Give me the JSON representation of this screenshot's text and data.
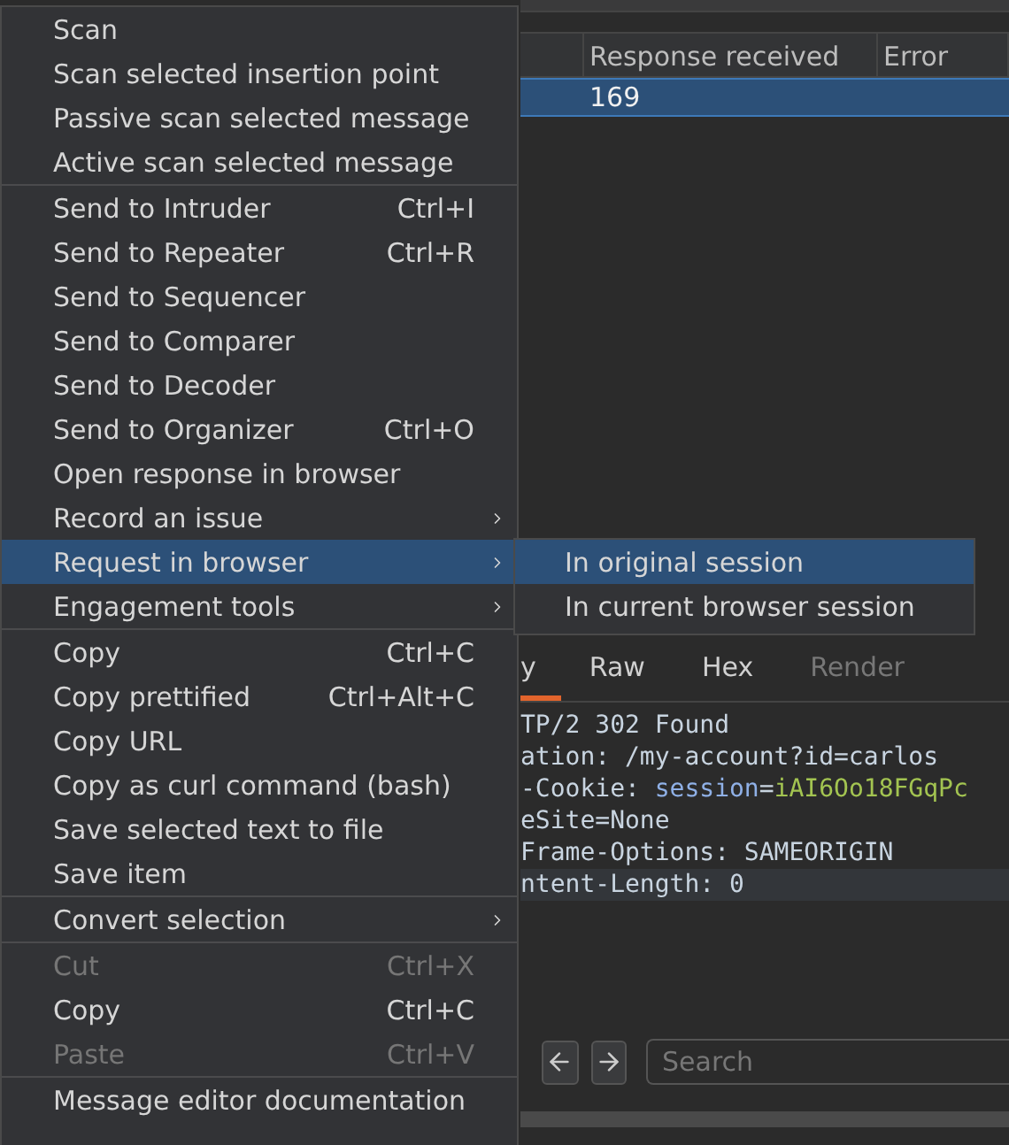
{
  "table": {
    "columns": [
      {
        "label": "Response received"
      },
      {
        "label": "Error"
      }
    ],
    "rows": [
      {
        "cells": [
          "169",
          ""
        ],
        "selected": true
      }
    ]
  },
  "editor": {
    "tabs": [
      {
        "label": "y",
        "selected": true,
        "disabled": false
      },
      {
        "label": "Raw",
        "selected": false,
        "disabled": false
      },
      {
        "label": "Hex",
        "selected": false,
        "disabled": false
      },
      {
        "label": "Render",
        "selected": false,
        "disabled": true
      }
    ],
    "lines": [
      {
        "highlighted": false,
        "segments": [
          {
            "kind": "plain",
            "text": "TP/2 302 Found"
          }
        ]
      },
      {
        "highlighted": false,
        "segments": [
          {
            "kind": "plain",
            "text": "ation: /my-account?id=carlos"
          }
        ]
      },
      {
        "highlighted": false,
        "segments": [
          {
            "kind": "plain",
            "text": "-Cookie: "
          },
          {
            "kind": "name",
            "text": "session"
          },
          {
            "kind": "plain",
            "text": "="
          },
          {
            "kind": "value",
            "text": "iAI6Oo18FGqPc"
          }
        ]
      },
      {
        "highlighted": false,
        "segments": [
          {
            "kind": "plain",
            "text": "eSite=None"
          }
        ]
      },
      {
        "highlighted": false,
        "segments": [
          {
            "kind": "plain",
            "text": "Frame-Options: SAMEORIGIN"
          }
        ]
      },
      {
        "highlighted": true,
        "segments": [
          {
            "kind": "plain",
            "text": "ntent-Length: 0"
          }
        ]
      }
    ],
    "search": {
      "placeholder": "Search"
    }
  },
  "context_menu": {
    "sections": [
      {
        "items": [
          {
            "label": "Scan"
          },
          {
            "label": "Scan selected insertion point"
          },
          {
            "label": "Passive scan selected message"
          },
          {
            "label": "Active scan selected message"
          }
        ]
      },
      {
        "items": [
          {
            "label": "Send to Intruder",
            "shortcut": "Ctrl+I"
          },
          {
            "label": "Send to Repeater",
            "shortcut": "Ctrl+R"
          },
          {
            "label": "Send to Sequencer"
          },
          {
            "label": "Send to Comparer"
          },
          {
            "label": "Send to Decoder"
          },
          {
            "label": "Send to Organizer",
            "shortcut": "Ctrl+O"
          },
          {
            "label": "Open response in browser"
          },
          {
            "label": "Record an issue",
            "submenu": true
          },
          {
            "label": "Request in browser",
            "submenu": true,
            "selected": true
          },
          {
            "label": "Engagement tools",
            "submenu": true
          }
        ]
      },
      {
        "items": [
          {
            "label": "Copy",
            "shortcut": "Ctrl+C"
          },
          {
            "label": "Copy prettified",
            "shortcut": "Ctrl+Alt+C"
          },
          {
            "label": "Copy URL"
          },
          {
            "label": "Copy as curl command (bash)"
          },
          {
            "label": "Save selected text to file"
          },
          {
            "label": "Save item"
          }
        ]
      },
      {
        "items": [
          {
            "label": "Convert selection",
            "submenu": true
          }
        ]
      },
      {
        "items": [
          {
            "label": "Cut",
            "shortcut": "Ctrl+X",
            "disabled": true
          },
          {
            "label": "Copy",
            "shortcut": "Ctrl+C"
          },
          {
            "label": "Paste",
            "shortcut": "Ctrl+V",
            "disabled": true
          }
        ]
      },
      {
        "items": [
          {
            "label": "Message editor documentation"
          }
        ]
      }
    ]
  },
  "submenu": {
    "items": [
      {
        "label": "In original session",
        "selected": true
      },
      {
        "label": "In current browser session",
        "selected": false
      }
    ]
  }
}
